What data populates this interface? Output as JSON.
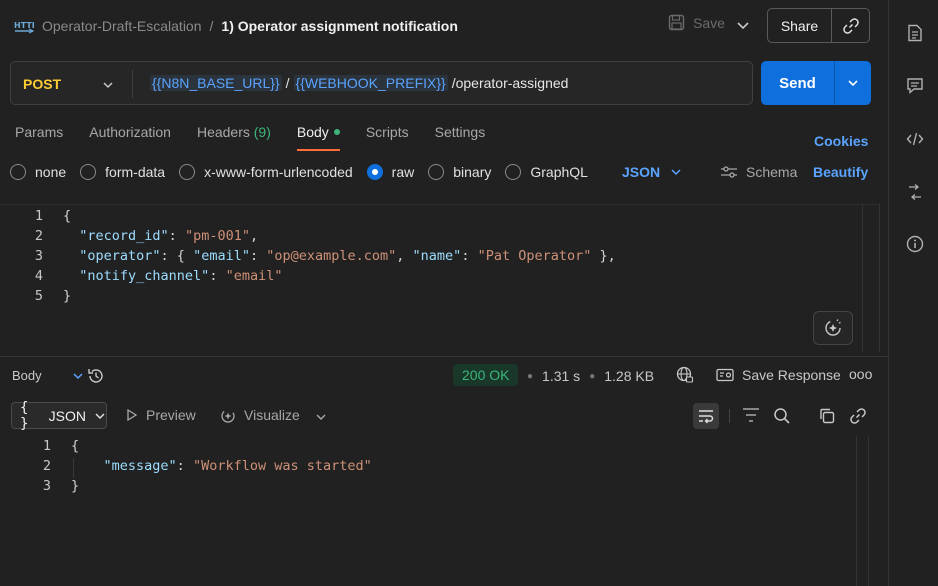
{
  "breadcrumb": {
    "parent": "Operator-Draft-Escalation",
    "separator": "/",
    "current": "1) Operator assignment notification"
  },
  "header": {
    "save_label": "Save",
    "share_label": "Share"
  },
  "request": {
    "method": "POST",
    "url_parts": [
      {
        "text": "{{N8N_BASE_URL}}",
        "kind": "var"
      },
      {
        "text": "/",
        "kind": "plain"
      },
      {
        "text": "{{WEBHOOK_PREFIX}}",
        "kind": "var"
      },
      {
        "text": "/operator-assigned",
        "kind": "plain"
      }
    ],
    "send_label": "Send"
  },
  "tabs": {
    "params": "Params",
    "authorization": "Authorization",
    "headers": "Headers",
    "headers_count": "(9)",
    "body": "Body",
    "scripts": "Scripts",
    "settings": "Settings",
    "active": "Body",
    "cookies": "Cookies"
  },
  "body_types": {
    "none": "none",
    "form_data": "form-data",
    "urlencoded": "x-www-form-urlencoded",
    "raw": "raw",
    "binary": "binary",
    "graphql": "GraphQL",
    "selected": "raw",
    "language": "JSON",
    "schema": "Schema",
    "beautify": "Beautify"
  },
  "request_body": {
    "line_numbers": [
      "1",
      "2",
      "3",
      "4",
      "5"
    ],
    "open_brace": "{",
    "close_brace": "}",
    "record_id_key": "\"record_id\"",
    "record_id_val": "\"pm-001\"",
    "operator_key": "\"operator\"",
    "email_key": "\"email\"",
    "email_val": "\"op@example.com\"",
    "name_key": "\"name\"",
    "name_val": "\"Pat Operator\"",
    "notify_key": "\"notify_channel\"",
    "notify_val": "\"email\""
  },
  "response": {
    "section_label": "Body",
    "status": "200 OK",
    "time": "1.31 s",
    "size": "1.28 KB",
    "save_response": "Save Response",
    "more": "ooo",
    "format": "JSON",
    "format_prefix": "{ }",
    "preview": "Preview",
    "visualize": "Visualize",
    "line_numbers": [
      "1",
      "2",
      "3"
    ],
    "open_brace": "{",
    "close_brace": "}",
    "message_key": "\"message\"",
    "message_val": "\"Workflow was started\""
  },
  "colors": {
    "accent": "#0f6fdd",
    "method": "#ffcc33",
    "status_ok": "#3db57a",
    "tab_underline": "#ff6c37",
    "link": "#5aa3ff"
  },
  "icons": [
    "http-icon",
    "save-icon",
    "chevron-down-icon",
    "link-icon",
    "document-icon",
    "comment-icon",
    "code-icon",
    "transform-icon",
    "info-icon",
    "history-icon",
    "globe-icon",
    "save-response-icon",
    "eye-icon",
    "visualize-icon",
    "wrap-icon",
    "filter-icon",
    "search-icon",
    "copy-icon",
    "magic-icon",
    "schema-icon"
  ]
}
